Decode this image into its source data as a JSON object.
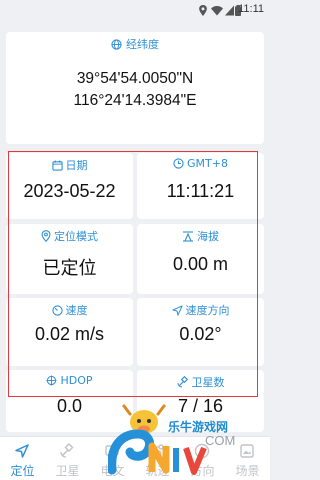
{
  "status_bar": {
    "time": "11:11"
  },
  "coordinates": {
    "title": "经纬度",
    "latitude": "39°54'54.0050\"N",
    "longitude": "116°24'14.3984\"E"
  },
  "cells": {
    "date": {
      "label": "日期",
      "value": "2023-05-22"
    },
    "timezone": {
      "label": "GMT+8",
      "value": "11:11:21"
    },
    "positioning_mode": {
      "label": "定位模式",
      "value": "已定位"
    },
    "altitude": {
      "label": "海拔",
      "value": "0.00 m"
    },
    "speed": {
      "label": "速度",
      "value": "0.02 m/s"
    },
    "speed_direction": {
      "label": "速度方向",
      "value": "0.02°"
    },
    "hdop": {
      "label": "HDOP",
      "value": "0.0"
    },
    "satellites": {
      "label": "卫星数",
      "value": "7 / 16"
    }
  },
  "tabs": [
    {
      "label": "定位",
      "icon": "navigation-icon",
      "active": true
    },
    {
      "label": "卫星",
      "icon": "satellite-icon",
      "active": false
    },
    {
      "label": "电文",
      "icon": "message-icon",
      "active": false
    },
    {
      "label": "轨迹",
      "icon": "track-icon",
      "active": false
    },
    {
      "label": "方向",
      "icon": "compass-icon",
      "active": false
    },
    {
      "label": "场景",
      "icon": "scene-icon",
      "active": false
    }
  ],
  "watermark": {
    "text": "乐牛游戏网",
    "domain": "COM",
    "logo": "6NIU"
  },
  "colors": {
    "accent": "#2f8fd8",
    "highlight_border": "#e23a3a",
    "inactive_tab": "#c0c3c8"
  }
}
